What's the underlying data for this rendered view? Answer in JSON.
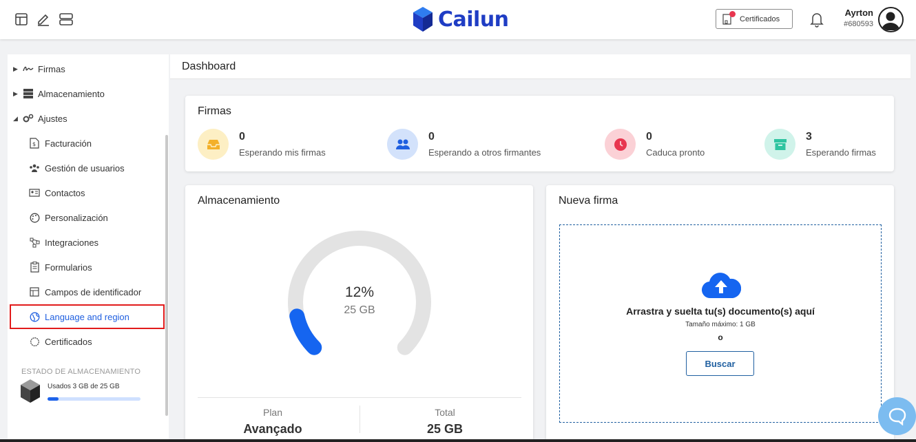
{
  "header": {
    "brand": "Cailun",
    "certificates_label": "Certificados",
    "user_name": "Ayrton",
    "user_id": "#680593"
  },
  "sidebar": {
    "firmas": "Firmas",
    "almacenamiento": "Almacenamiento",
    "ajustes": "Ajustes",
    "subitems": {
      "facturacion": "Facturación",
      "usuarios": "Gestión de usuarios",
      "contactos": "Contactos",
      "personalizacion": "Personalización",
      "integraciones": "Integraciones",
      "formularios": "Formularios",
      "campos": "Campos de identificador",
      "language": "Language and region",
      "certificados": "Certificados"
    },
    "storage_status_title": "ESTADO DE ALMACENAMIENTO",
    "storage_status_text": "Usados 3 GB de 25 GB",
    "storage_used_fraction": 0.12
  },
  "main": {
    "title": "Dashboard",
    "firmas_card": {
      "title": "Firmas",
      "stats": [
        {
          "value": "0",
          "label": "Esperando mis firmas"
        },
        {
          "value": "0",
          "label": "Esperando a otros firmantes"
        },
        {
          "value": "0",
          "label": "Caduca pronto"
        },
        {
          "value": "3",
          "label": "Esperando firmas"
        }
      ]
    },
    "storage_card": {
      "title": "Almacenamiento",
      "percent": "12%",
      "percent_value": 12,
      "size": "25 GB",
      "plan_label": "Plan",
      "plan_value": "Avançado",
      "total_label": "Total",
      "total_value": "25 GB"
    },
    "new_sign_card": {
      "title": "Nueva firma",
      "drop_text": "Arrastra y suelta tu(s) documento(s) aquí",
      "max_size": "Tamaño máximo: 1 GB",
      "or": "o",
      "search_button": "Buscar"
    }
  },
  "colors": {
    "accent": "#1e63ea",
    "highlight": "#e11a1a"
  }
}
